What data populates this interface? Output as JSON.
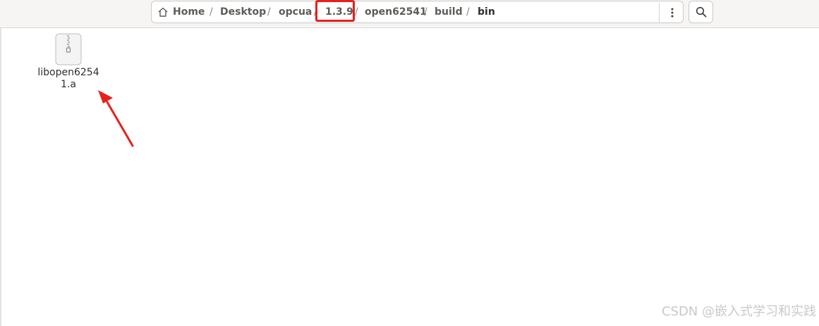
{
  "pathbar": {
    "home_label": "Home",
    "separator": "/",
    "crumbs": [
      "Desktop",
      "opcua",
      "1.3.9",
      "open62541",
      "build",
      "bin"
    ],
    "highlighted_crumb": "1.3.9"
  },
  "toolbar": {
    "menu_icon": "kebab-menu-icon",
    "search_icon": "search-icon"
  },
  "files": [
    {
      "name": "libopen62541.a",
      "icon": "archive-file-icon"
    }
  ],
  "annotation": {
    "arrow_color": "#e8201c",
    "highlight_color": "#e8201c"
  },
  "watermark": "CSDN @嵌入式学习和实践"
}
